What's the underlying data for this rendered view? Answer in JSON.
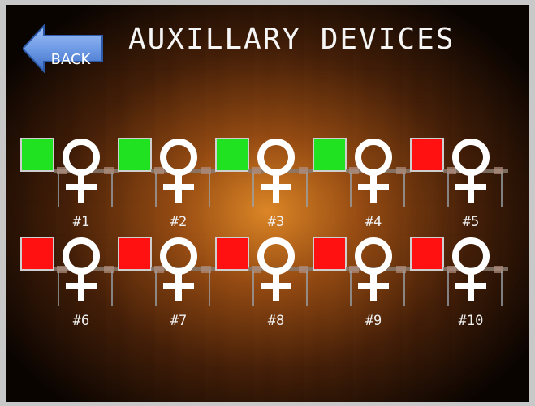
{
  "header": {
    "back_label": "BACK",
    "title": "AUXILLARY DEVICES"
  },
  "colors": {
    "on": "#21e221",
    "off": "#ff1111",
    "back_button": "#6f9be6"
  },
  "devices": [
    {
      "label": "#1",
      "status": "on"
    },
    {
      "label": "#2",
      "status": "on"
    },
    {
      "label": "#3",
      "status": "on"
    },
    {
      "label": "#4",
      "status": "on"
    },
    {
      "label": "#5",
      "status": "off"
    },
    {
      "label": "#6",
      "status": "off"
    },
    {
      "label": "#7",
      "status": "off"
    },
    {
      "label": "#8",
      "status": "off"
    },
    {
      "label": "#9",
      "status": "off"
    },
    {
      "label": "#10",
      "status": "off"
    }
  ],
  "icons": {
    "device_symbol": "female-symbol-icon",
    "back_arrow": "back-arrow-icon"
  }
}
